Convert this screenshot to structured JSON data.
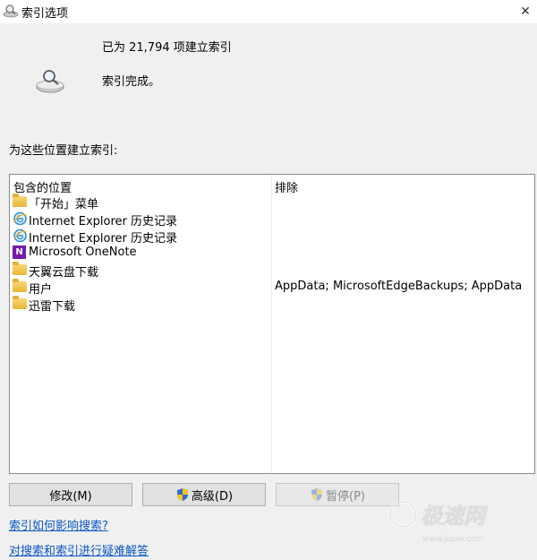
{
  "window": {
    "title": "索引选项",
    "close_glyph": "✕"
  },
  "status": {
    "line1": "已为 21,794 项建立索引",
    "line2": "索引完成。",
    "icon": "magnifier-drive-icon"
  },
  "locations_label": "为这些位置建立索引:",
  "list": {
    "headers": {
      "included": "包含的位置",
      "exclude": "排除"
    },
    "rows": [
      {
        "name": "「开始」菜单",
        "exclude": "",
        "icon": "folder-icon"
      },
      {
        "name": "Internet Explorer 历史记录",
        "exclude": "",
        "icon": "ie-icon"
      },
      {
        "name": "Internet Explorer 历史记录",
        "exclude": "",
        "icon": "ie-icon"
      },
      {
        "name": "Microsoft OneNote",
        "exclude": "",
        "icon": "onenote-icon"
      },
      {
        "name": "天翼云盘下载",
        "exclude": "",
        "icon": "folder-icon"
      },
      {
        "name": "用户",
        "exclude": "AppData; MicrosoftEdgeBackups; AppData",
        "icon": "folder-icon"
      },
      {
        "name": "迅雷下载",
        "exclude": "",
        "icon": "folder-icon"
      }
    ]
  },
  "buttons": {
    "modify": "修改(M)",
    "advanced": "高级(D)",
    "pause": "暂停(P)"
  },
  "links": {
    "how_affects": "索引如何影响搜索?",
    "troubleshoot": "对搜索和索引进行疑难解答"
  },
  "watermark": {
    "text": "极速网",
    "sub": "www.jisuw.com"
  },
  "colors": {
    "link": "#0a57c5",
    "onenote": "#7719aa",
    "folder": "#e9b636"
  }
}
